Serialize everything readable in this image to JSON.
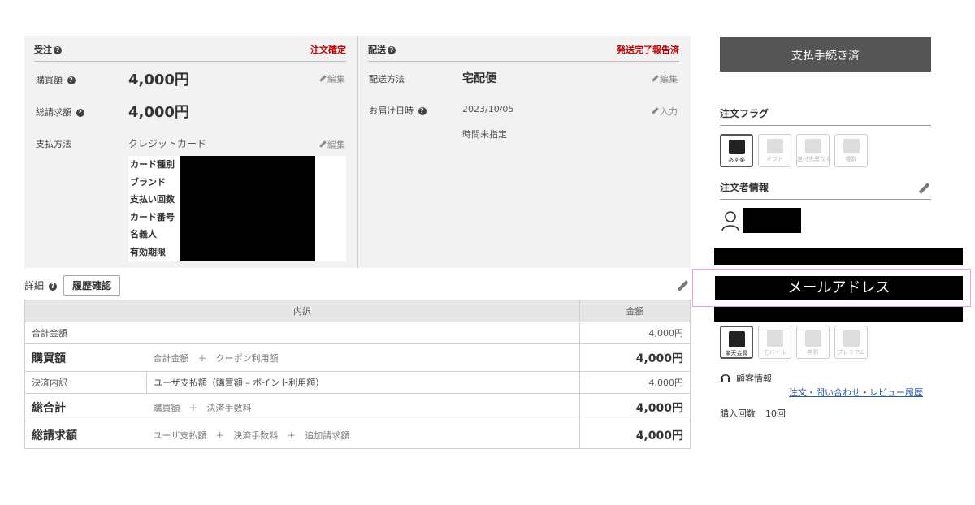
{
  "order_panel": {
    "title": "受注",
    "status": "注文確定",
    "purchase_label": "購買額",
    "purchase_value": "4,000円",
    "total_label": "総請求額",
    "total_value": "4,000円",
    "payment_label": "支払方法",
    "payment_value": "クレジットカード",
    "edit_label": "編集",
    "card_rows": [
      "カード種別",
      "ブランド",
      "支払い回数",
      "カード番号",
      "名義人",
      "有効期限"
    ]
  },
  "ship_panel": {
    "title": "配送",
    "status": "発送完了報告済",
    "method_label": "配送方法",
    "method_value": "宅配便",
    "edit_label": "編集",
    "date_label": "お届け日時",
    "date_value": "2023/10/05",
    "time_value": "時間未指定",
    "input_label": "入力"
  },
  "details": {
    "title": "詳細",
    "history_button": "履歴確認",
    "headers": [
      "内訳",
      "金額"
    ],
    "rows": [
      {
        "label": "合計金額",
        "desc": "",
        "amount": "4,000円"
      },
      {
        "label": "購買額",
        "desc": "合計金額　＋　クーポン利用額",
        "amount": "4,000円"
      },
      {
        "label": "決済内訳",
        "desc": "ユーザ支払額（購買額 – ポイント利用額）",
        "amount": "4,000円"
      },
      {
        "label": "総合計",
        "desc": "購買額　＋　決済手数料",
        "amount": "4,000円"
      },
      {
        "label": "総請求額",
        "desc": "ユーザ支払額　＋　決済手数料　＋　追加請求額",
        "amount": "4,000円"
      }
    ]
  },
  "sidebar": {
    "pay_button": "支払手続き済",
    "flags_title": "注文フラグ",
    "flags": [
      "あす楽",
      "ギフト",
      "送付先異なる",
      "複数"
    ],
    "orderer_title": "注文者情報",
    "email_label": "メールアドレス",
    "member_badges": [
      "楽天会員",
      "モバイル",
      "学割",
      "プレミアム"
    ],
    "customer_info": "顧客情報",
    "history_link": "注文・問い合わせ・レビュー履歴",
    "purchase_count_label": "購入回数",
    "purchase_count": "10回"
  },
  "colors": {
    "status_red": "#c00000",
    "panel_bg": "#f2f2f2",
    "button_dark": "#555555",
    "email_frame": "#ee9cf0"
  }
}
